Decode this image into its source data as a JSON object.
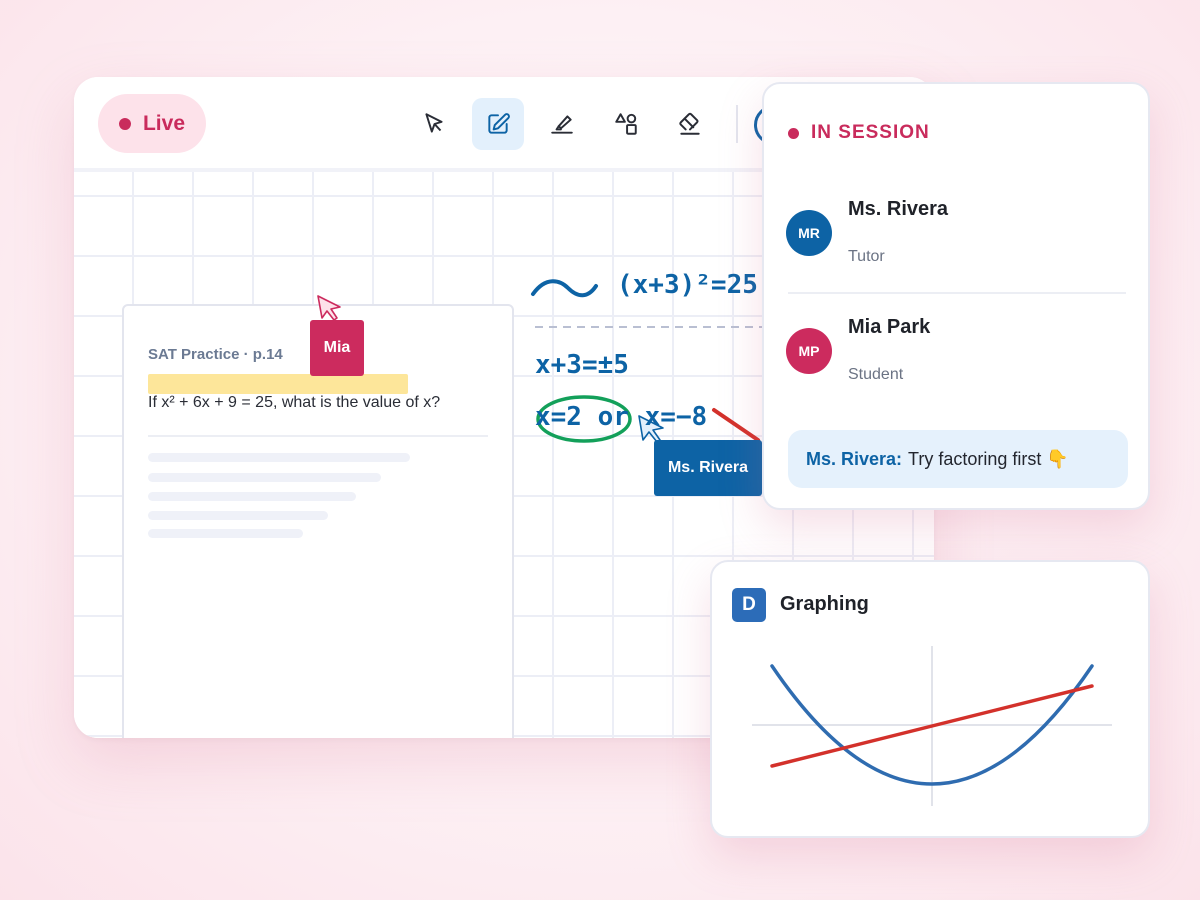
{
  "toolbar": {
    "live_label": "Live",
    "tools": [
      {
        "name": "select",
        "icon": "cursor-arrow-icon",
        "active": false
      },
      {
        "name": "pen",
        "icon": "pen-edit-icon",
        "active": true
      },
      {
        "name": "highlighter",
        "icon": "highlighter-icon",
        "active": false
      },
      {
        "name": "shapes",
        "icon": "shapes-icon",
        "active": false
      },
      {
        "name": "eraser",
        "icon": "eraser-icon",
        "active": false
      }
    ]
  },
  "worksheet": {
    "title": "SAT Practice · p.14",
    "question": "If x² + 6x + 9 = 25, what is the value of x?"
  },
  "cursors": {
    "student_name": "Mia",
    "tutor_name": "Ms. Rivera"
  },
  "handwriting": {
    "line1": "(x+3)²=25",
    "line2": "x+3=±5",
    "line3": "x=2 or x=−8"
  },
  "session": {
    "status": "IN SESSION",
    "members": [
      {
        "initials": "MR",
        "name": "Ms. Rivera",
        "role": "Tutor",
        "color": "#0d63a5"
      },
      {
        "initials": "MP",
        "name": "Mia Park",
        "role": "Student",
        "color": "#cc2b5e"
      }
    ],
    "chat": {
      "sender": "Ms. Rivera:",
      "message": "Try factoring first 👇"
    }
  },
  "graphing": {
    "logo_letter": "D",
    "title": "Graphing",
    "curve_color": "#2f6cb0",
    "line_color": "#d3312b"
  },
  "colors": {
    "accent_blue": "#0d63a5",
    "accent_pink": "#c92b5c",
    "circle_green": "#13a05a"
  }
}
